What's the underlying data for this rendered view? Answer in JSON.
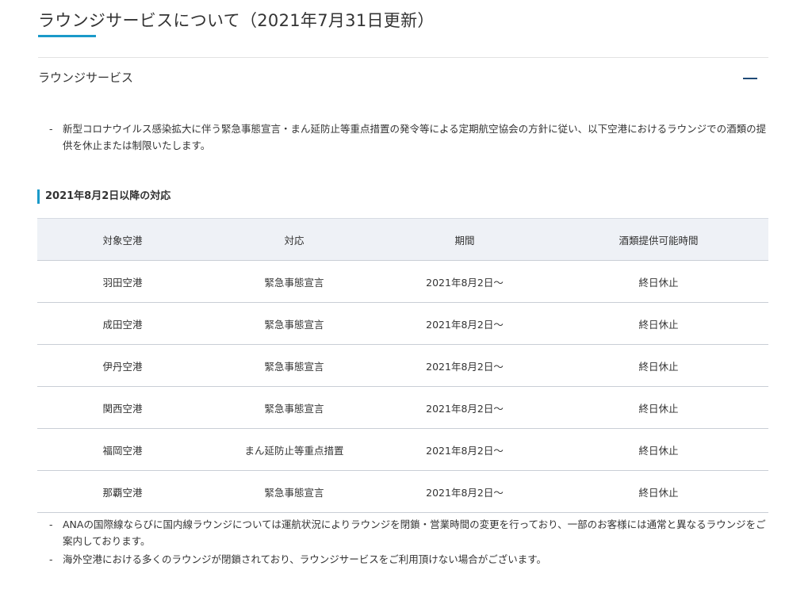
{
  "page": {
    "title": "ラウンジサービスについて（2021年7月31日更新）"
  },
  "accordion": {
    "label": "ラウンジサービス",
    "toggle_icon": "minus-icon"
  },
  "notice_top": {
    "dash": "-",
    "text": "新型コロナウイルス感染拡大に伴う緊急事態宣言・まん延防止等重点措置の発令等による定期航空協会の方針に従い、以下空港におけるラウンジでの酒類の提供を休止または制限いたします。"
  },
  "section": {
    "heading": "2021年8月2日以降の対応"
  },
  "table": {
    "headers": [
      "対象空港",
      "対応",
      "期間",
      "酒類提供可能時間"
    ],
    "rows": [
      [
        "羽田空港",
        "緊急事態宣言",
        "2021年8月2日〜",
        "終日休止"
      ],
      [
        "成田空港",
        "緊急事態宣言",
        "2021年8月2日〜",
        "終日休止"
      ],
      [
        "伊丹空港",
        "緊急事態宣言",
        "2021年8月2日〜",
        "終日休止"
      ],
      [
        "関西空港",
        "緊急事態宣言",
        "2021年8月2日〜",
        "終日休止"
      ],
      [
        "福岡空港",
        "まん延防止等重点措置",
        "2021年8月2日〜",
        "終日休止"
      ],
      [
        "那覇空港",
        "緊急事態宣言",
        "2021年8月2日〜",
        "終日休止"
      ]
    ]
  },
  "notes": [
    {
      "dash": "-",
      "text": "ANAの国際線ならびに国内線ラウンジについては運航状況によりラウンジを閉鎖・営業時間の変更を行っており、一部のお客様には通常と異なるラウンジをご案内しております。"
    },
    {
      "dash": "-",
      "text": "海外空港における多くのラウンジが閉鎖されており、ラウンジサービスをご利用頂けない場合がございます。"
    }
  ],
  "colors": {
    "accent": "#1a9ac9",
    "toggle": "#1f4a76",
    "table_header_bg": "#eef1f6",
    "border": "#c9ced6"
  }
}
